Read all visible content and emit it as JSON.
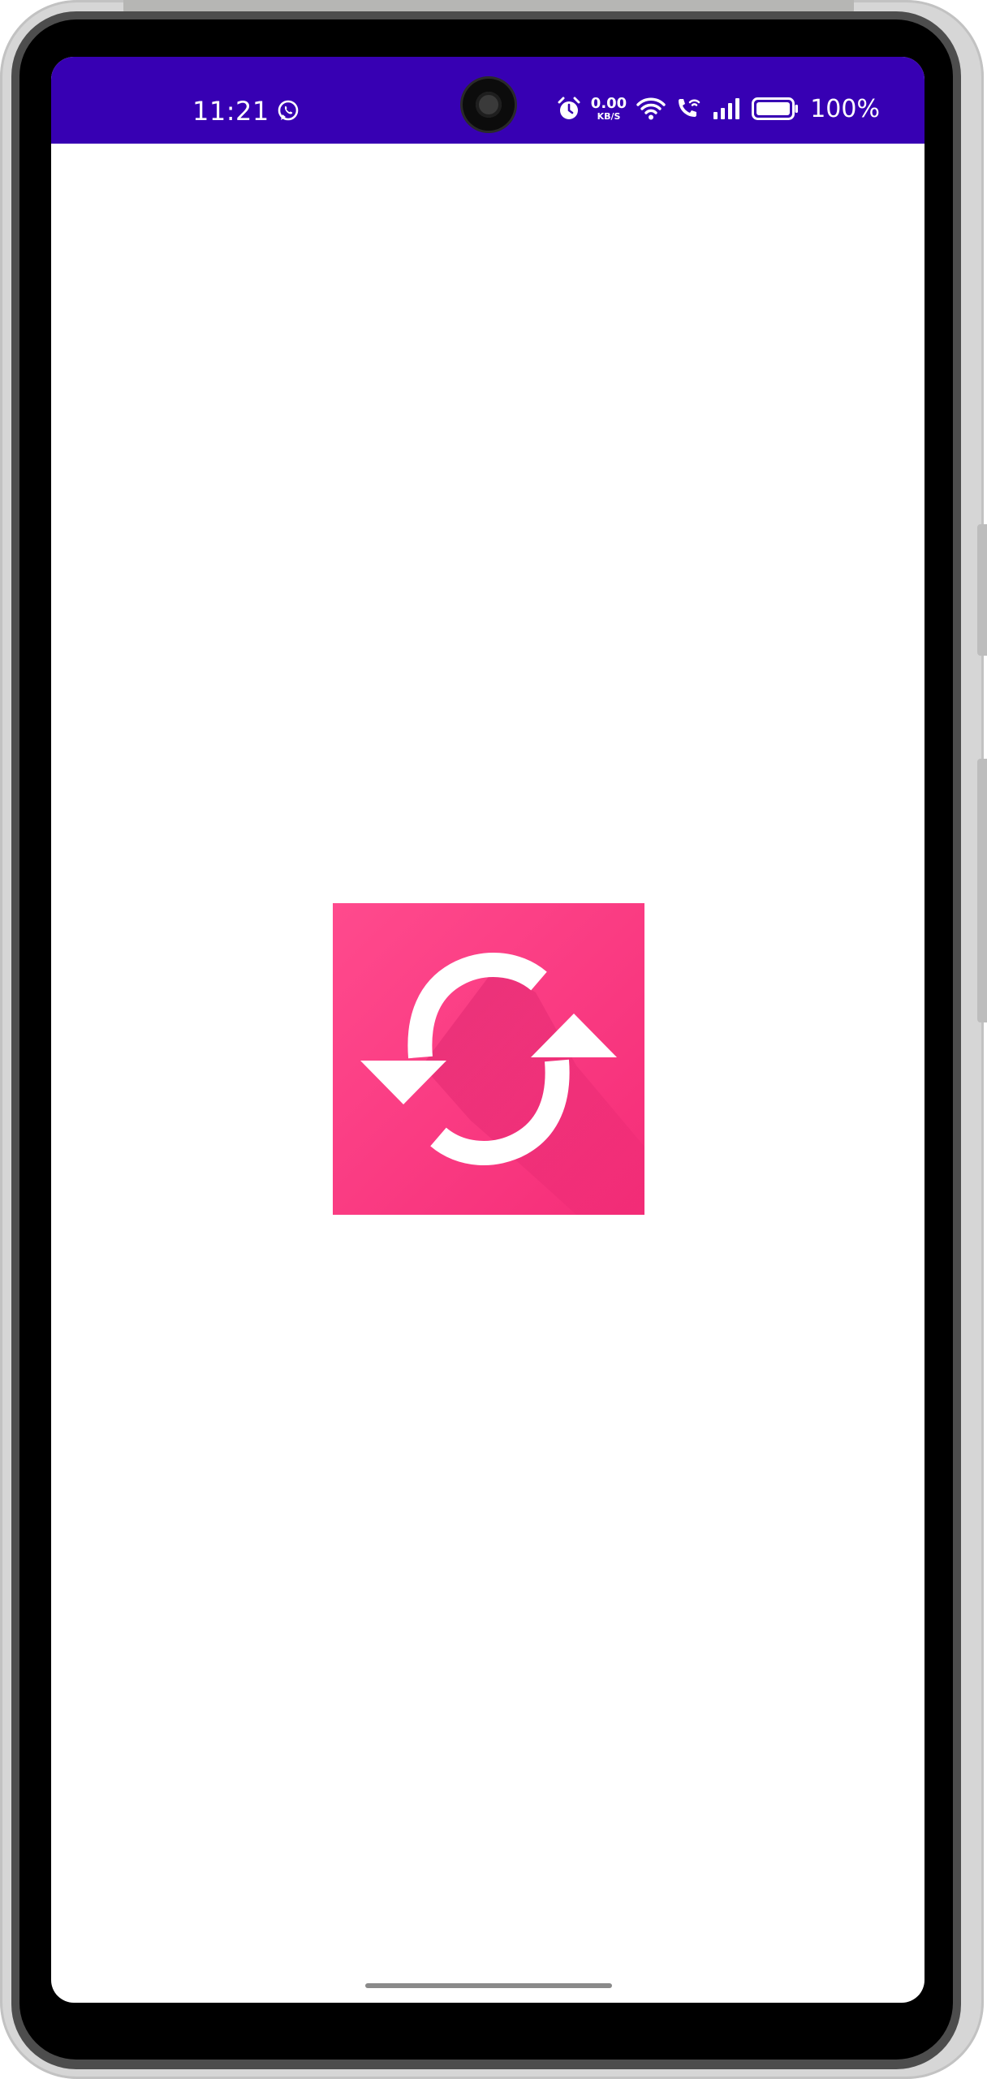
{
  "status_bar": {
    "time": "11:21",
    "net_speed_value": "0.00",
    "net_speed_unit": "KB/S",
    "battery_percent": "100%",
    "background_color": "#3700b3",
    "icons": [
      "whatsapp-icon",
      "alarm-icon",
      "wifi-icon",
      "wifi-calling-icon",
      "signal-icon",
      "battery-icon"
    ]
  },
  "splash": {
    "logo_icon": "sync-arrows-icon",
    "logo_color": "#ff3d7f"
  },
  "navigation": {
    "gesture_handle": "home-indicator"
  }
}
